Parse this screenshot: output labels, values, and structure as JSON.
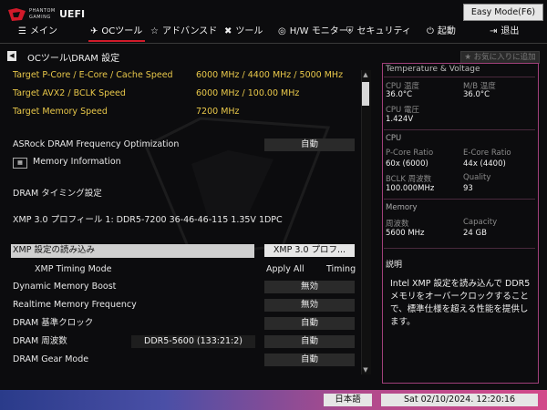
{
  "brand": {
    "line1": "PHANTOM",
    "line2": "GAMING",
    "uefi": "UEFI"
  },
  "easy_mode_button": "Easy Mode(F6)",
  "nav": [
    {
      "label": "メイン",
      "icon": "list-icon"
    },
    {
      "label": "OCツール",
      "icon": "rocket-icon",
      "active": true
    },
    {
      "label": "アドバンスド",
      "icon": "star-icon"
    },
    {
      "label": "ツール",
      "icon": "tools-icon"
    },
    {
      "label": "H/W モニター",
      "icon": "monitor-icon"
    },
    {
      "label": "セキュリティ",
      "icon": "shield-icon"
    },
    {
      "label": "起動",
      "icon": "power-icon"
    },
    {
      "label": "退出",
      "icon": "exit-icon"
    }
  ],
  "breadcrumb": "OCツール\\DRAM 設定",
  "favorite_button": "お気に入りに追加",
  "targets": [
    {
      "label": "Target P-Core / E-Core / Cache Speed",
      "value": "6000 MHz / 4400 MHz / 5000 MHz"
    },
    {
      "label": "Target AVX2 / BCLK Speed",
      "value": "6000 MHz / 100.00 MHz"
    },
    {
      "label": "Target Memory Speed",
      "value": "7200 MHz"
    }
  ],
  "settings": {
    "dram_freq_opt": {
      "label": "ASRock DRAM Frequency Optimization",
      "value": "自動"
    },
    "mem_info": {
      "label": "Memory Information"
    },
    "timing_header": "DRAM タイミング設定",
    "xmp_profile_text": "XMP 3.0 プロフィール 1: DDR5-7200 36-46-46-115 1.35V 1DPC",
    "xmp_load": {
      "label": "XMP 設定の読み込み",
      "value": "XMP 3.0 プロフ..."
    },
    "xmp_timing": {
      "label": "XMP Timing Mode",
      "value": "Apply All",
      "value2": "Timing"
    },
    "dyn_boost": {
      "label": "Dynamic Memory Boost",
      "value": "無効"
    },
    "realtime": {
      "label": "Realtime Memory Frequency",
      "value": "無効"
    },
    "base_clock": {
      "label": "DRAM 基準クロック",
      "value": "自動"
    },
    "dram_freq": {
      "label": "DRAM 周波数",
      "current": "DDR5-5600 (133:21:2)",
      "value": "自動"
    },
    "gear": {
      "label": "DRAM Gear Mode",
      "value": "自動"
    }
  },
  "panel": {
    "title": "Temperature & Voltage",
    "cpu_temp_label": "CPU 温度",
    "cpu_temp": "36.0°C",
    "mb_temp_label": "M/B 温度",
    "mb_temp": "36.0°C",
    "cpu_volt_label": "CPU 電圧",
    "cpu_volt": "1.424V",
    "cpu_section": "CPU",
    "pcore_label": "P-Core Ratio",
    "pcore": "60x (6000)",
    "ecore_label": "E-Core Ratio",
    "ecore": "44x (4400)",
    "bclk_label": "BCLK 周波数",
    "bclk": "100.000MHz",
    "quality_label": "Quality",
    "quality": "93",
    "mem_section": "Memory",
    "freq_label": "周波数",
    "freq": "5600 MHz",
    "cap_label": "Capacity",
    "cap": "24 GB"
  },
  "description": {
    "title": "説明",
    "text": "Intel XMP 設定を読み込んで DDR5 メモリをオーバークロックすることで、標準仕様を超える性能を提供します。"
  },
  "language_button": "日本語",
  "datetime": "Sat 02/10/2024. 12:20:16",
  "colors": {
    "accent": "#d11a2a",
    "target_yellow": "#e9c84a",
    "panel_border": "#a0407a"
  }
}
